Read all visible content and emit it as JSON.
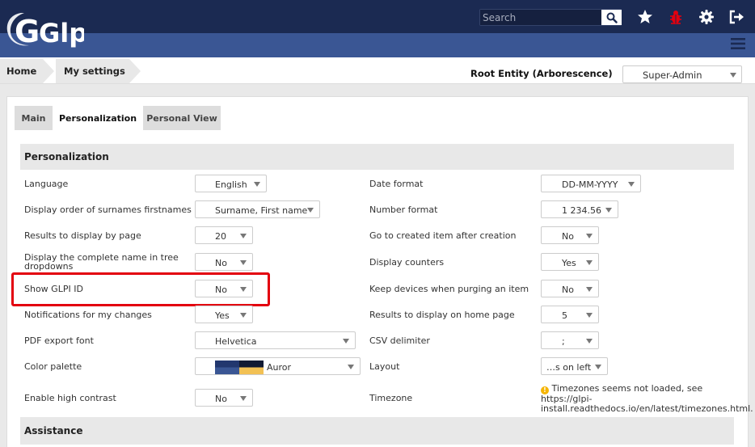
{
  "header": {
    "logo_text": "Glpi",
    "search": {
      "placeholder": "Search",
      "value": ""
    },
    "icons": [
      "search-icon",
      "star-icon",
      "bug-icon",
      "gear-icon",
      "logout-icon",
      "hamburger-menu-icon"
    ]
  },
  "breadcrumb": {
    "items": [
      "Home",
      "My settings"
    ]
  },
  "entity": {
    "label": "Root Entity (Arborescence)",
    "profile": "Super-Admin"
  },
  "tabs": [
    "Main",
    "Personalization",
    "Personal View"
  ],
  "sections": {
    "personalization": "Personalization",
    "assistance": "Assistance"
  },
  "left_fields": [
    {
      "label": "Language",
      "value": "English"
    },
    {
      "label": "Display order of surnames firstnames",
      "value": "Surname, First name"
    },
    {
      "label": "Results to display by page",
      "value": "20"
    },
    {
      "label": "Display the complete name in tree dropdowns",
      "value": "No"
    },
    {
      "label": "Show GLPI ID",
      "value": "No"
    },
    {
      "label": "Notifications for my changes",
      "value": "Yes"
    },
    {
      "label": "PDF export font",
      "value": "Helvetica"
    },
    {
      "label": "Color palette",
      "value": "Auror"
    },
    {
      "label": "Enable high contrast",
      "value": "No"
    }
  ],
  "right_fields": [
    {
      "label": "Date format",
      "value": "DD-MM-YYYY"
    },
    {
      "label": "Number format",
      "value": "1 234.56"
    },
    {
      "label": "Go to created item after creation",
      "value": "No"
    },
    {
      "label": "Display counters",
      "value": "Yes"
    },
    {
      "label": "Keep devices when purging an item",
      "value": "No"
    },
    {
      "label": "Results to display on home page",
      "value": "5"
    },
    {
      "label": "CSV delimiter",
      "value": ";"
    },
    {
      "label": "Layout",
      "value": "…s on left"
    },
    {
      "label": "Timezone",
      "note": "Timezones seems not loaded, see https://glpi-install.readthedocs.io/en/latest/timezones.html."
    }
  ],
  "colors": {
    "header": "#1b2a52",
    "header_band": "#3a5694",
    "highlight": "#e3000f",
    "warning": "#f5b400",
    "bug_icon": "#e3000f"
  }
}
